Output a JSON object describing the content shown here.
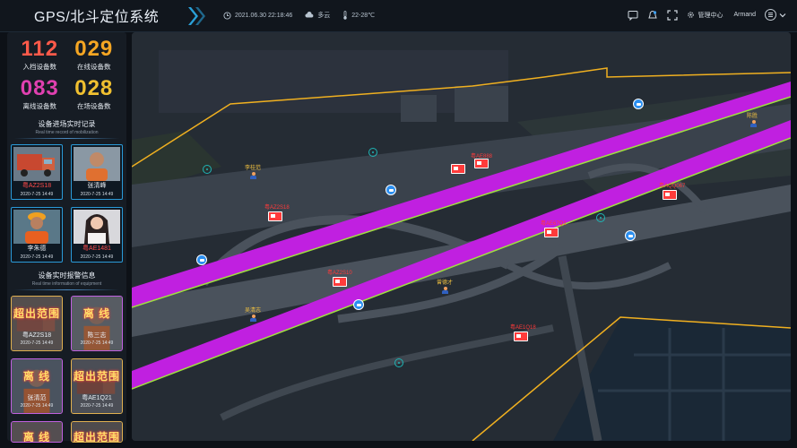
{
  "header": {
    "title": "GPS/北斗定位系统",
    "datetime": "2021.06.30  22:18:46",
    "weather": "多云",
    "temperature": "22-28℃",
    "management": "管理中心",
    "user": "Armand"
  },
  "stats": [
    {
      "value": "112",
      "label": "入档设备数",
      "color": "#ff5a4a"
    },
    {
      "value": "029",
      "label": "在线设备数",
      "color": "#f5a623"
    },
    {
      "value": "083",
      "label": "离线设备数",
      "color": "#e040b0"
    },
    {
      "value": "028",
      "label": "在场设备数",
      "color": "#f0c030"
    }
  ],
  "mobilization": {
    "title": "设备进场实时记录",
    "subtitle": "Real time record of mobilization",
    "cards": [
      {
        "name": "粤AZ2S18",
        "time": "2020-7-25 14:49",
        "alert": true
      },
      {
        "name": "张清峰",
        "time": "2020-7-25 14:49",
        "alert": false
      },
      {
        "name": "李朱德",
        "time": "2020-7-25 14:49",
        "alert": false
      },
      {
        "name": "粤AE1481",
        "time": "2020-7-25 14:49",
        "alert": true
      }
    ]
  },
  "alarms": {
    "title": "设备实时报警信息",
    "subtitle": "Real time information of equipment",
    "cards": [
      {
        "badge": "超出范围",
        "name": "粤AZ2S18",
        "time": "2020-7-25 14:49",
        "style": "gold"
      },
      {
        "badge": "离 线",
        "name": "陈三志",
        "time": "2020-7-25 14:49",
        "style": "purple"
      },
      {
        "badge": "离 线",
        "name": "张清范",
        "time": "2020-7-25 14:49",
        "style": "purple"
      },
      {
        "badge": "超出范围",
        "name": "粤AE1Q21",
        "time": "2020-7-25 14:49",
        "style": "gold"
      },
      {
        "badge": "离 线",
        "name": "",
        "time": "",
        "style": "purple"
      },
      {
        "badge": "超出范围",
        "name": "",
        "time": "",
        "style": "gold"
      }
    ]
  },
  "map": {
    "people": [
      {
        "name": "李桂范"
      },
      {
        "name": "陈胜"
      },
      {
        "name": "曾德才"
      },
      {
        "name": "吴清志"
      }
    ],
    "vehicles": [
      {
        "plate": "粤AE888"
      },
      {
        "plate": "粤AZ2S18"
      },
      {
        "plate": "粤AQQ067"
      },
      {
        "plate": "粤AE67Q1"
      },
      {
        "plate": "粤AZ2S10"
      },
      {
        "plate": "粤AE1Q18"
      }
    ],
    "road_color": "#c020e0",
    "boundary_color": "#f0b020"
  }
}
